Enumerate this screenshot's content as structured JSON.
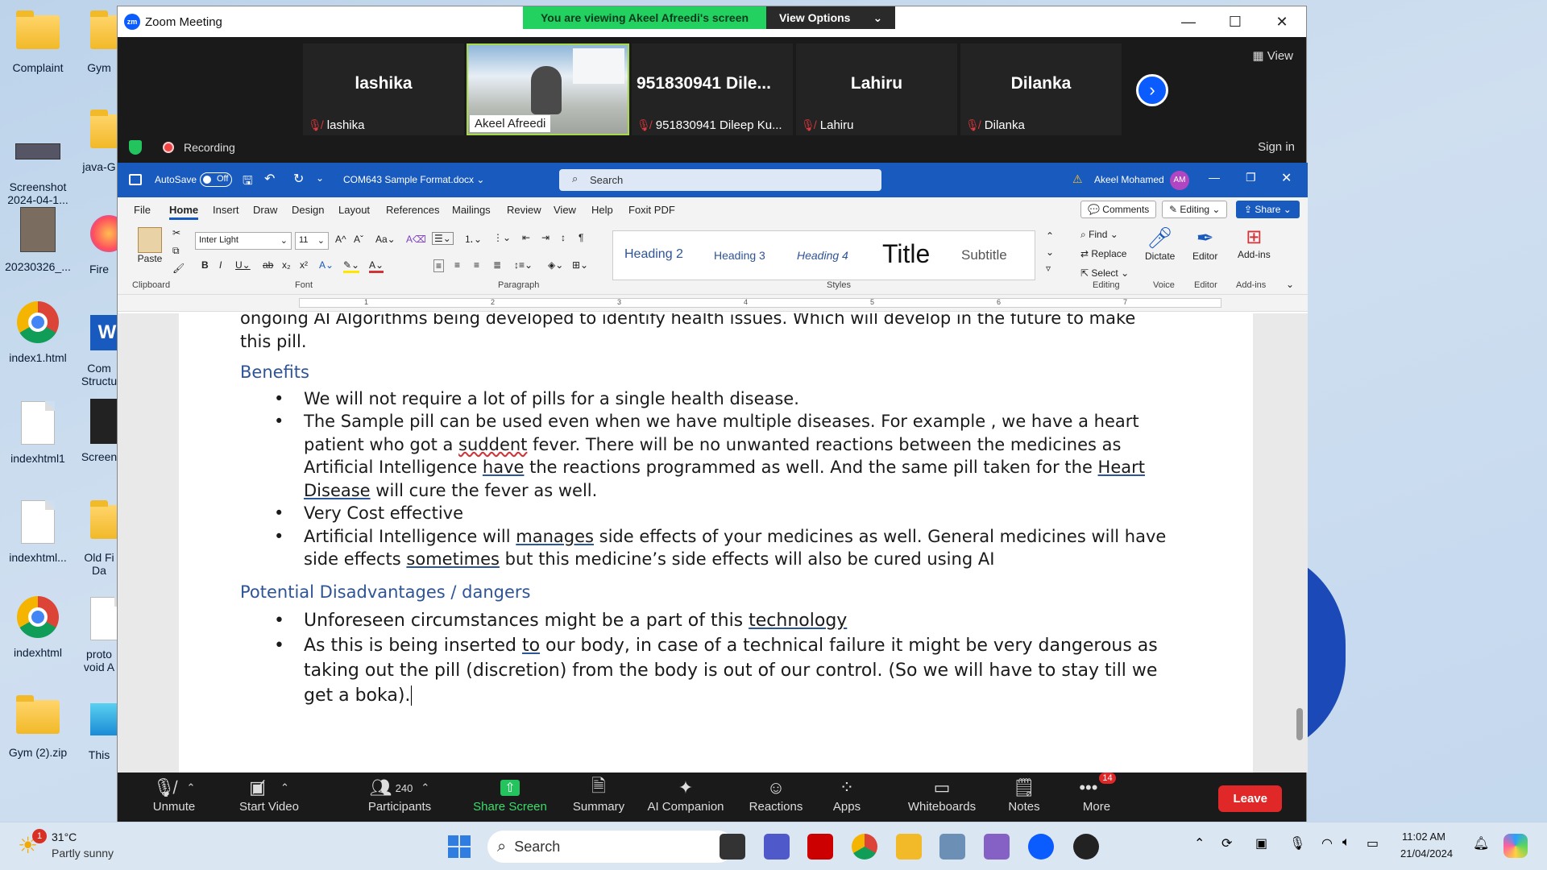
{
  "desktop": {
    "icons": [
      "Complaint",
      "Screenshot 2024-04-1...",
      "20230326_...",
      "index1.html",
      "indexhtml1",
      "indexhtml...",
      "indexhtml",
      "Gym (2).zip"
    ],
    "icons_col2": [
      "Gym",
      "java-G",
      "Fire",
      "Com Structu",
      "Screen",
      "Old Fi Da",
      "proto void A",
      "This"
    ]
  },
  "zoom": {
    "title": "Zoom Meeting",
    "banner": "You are viewing Akeel Afreedi's screen",
    "view_options": "View Options",
    "view_label": "View",
    "participants": [
      {
        "name": "lashika",
        "label": "lashika"
      },
      {
        "name": "",
        "label": "Akeel Afreedi"
      },
      {
        "name": "951830941  Dile...",
        "label": "951830941 Dileep Ku..."
      },
      {
        "name": "Lahiru",
        "label": "Lahiru"
      },
      {
        "name": "Dilanka",
        "label": "Dilanka"
      }
    ],
    "recording": "Recording",
    "sign_in": "Sign in",
    "toolbar": {
      "unmute": "Unmute",
      "start_video": "Start Video",
      "participants": "Participants",
      "participant_count": "240",
      "share_screen": "Share Screen",
      "summary": "Summary",
      "ai_companion": "AI Companion",
      "reactions": "Reactions",
      "apps": "Apps",
      "whiteboards": "Whiteboards",
      "notes": "Notes",
      "more": "More",
      "more_badge": "14",
      "leave": "Leave"
    }
  },
  "word": {
    "autosave": "AutoSave",
    "autosave_state": "Off",
    "filename": "COM643 Sample Format.docx",
    "search_placeholder": "Search",
    "user": "Akeel Mohamed",
    "user_initials": "AM",
    "tabs": [
      "File",
      "Home",
      "Insert",
      "Draw",
      "Design",
      "Layout",
      "References",
      "Mailings",
      "Review",
      "View",
      "Help",
      "Foxit PDF"
    ],
    "comments": "Comments",
    "editing": "Editing",
    "share": "Share",
    "font_name": "Inter Light",
    "font_size": "11",
    "styles": [
      "Heading 2",
      "Heading 3",
      "Heading 4",
      "Title",
      "Subtitle"
    ],
    "find": "Find",
    "replace": "Replace",
    "select": "Select",
    "dictate": "Dictate",
    "editor": "Editor",
    "addins": "Add-ins",
    "paste": "Paste",
    "groups": {
      "clipboard": "Clipboard",
      "font": "Font",
      "paragraph": "Paragraph",
      "styles": "Styles",
      "editing": "Editing",
      "voice": "Voice",
      "editor": "Editor",
      "addins": "Add-ins"
    },
    "ruler_numbers": [
      "1",
      "1",
      "2",
      "3",
      "4",
      "5",
      "6",
      "7"
    ]
  },
  "document": {
    "intro_1": "ongoing AI Algorithms being developed to identify health issues. Which will develop in the future to make",
    "intro_2": "this pill.",
    "heading_benefits": "Benefits",
    "b1": "We will not require a lot of pills for a single health disease.",
    "b2_a": "The Sample pill can be used even when we have multiple diseases. For example , we have a heart patient who got a ",
    "b2_sq": "suddent",
    "b2_b": " fever. There will be no unwanted reactions between the medicines as Artificial Intelligence ",
    "b2_have": "have",
    "b2_c": " the reactions programmed as well. And the same pill taken for the ",
    "b2_heart": "Heart Disease",
    "b2_d": " will cure the fever as well.",
    "b3": "Very Cost effective",
    "b4_a": "Artificial Intelligence will ",
    "b4_manages": "manages",
    "b4_b": " side effects of your medicines as well. General medicines will have side effects ",
    "b4_sometimes": "sometimes",
    "b4_c": " but this medicine’s side effects will also be cured using AI",
    "heading_disadv": "Potential Disadvantages / dangers",
    "d1_a": "Unforeseen circumstances might be a part of this ",
    "d1_tech": "technology",
    "d2_a": "As this is being inserted ",
    "d2_to": "to",
    "d2_b": " our body, in case of a technical failure it might be very dangerous as taking out the pill (discretion) from the body is out of our control. (So we will have to stay till we get a boka)."
  },
  "taskbar": {
    "weather_temp": "31°C",
    "weather_desc": "Partly sunny",
    "weather_badge": "1",
    "search": "Search",
    "time": "11:02 AM",
    "date": "21/04/2024"
  }
}
